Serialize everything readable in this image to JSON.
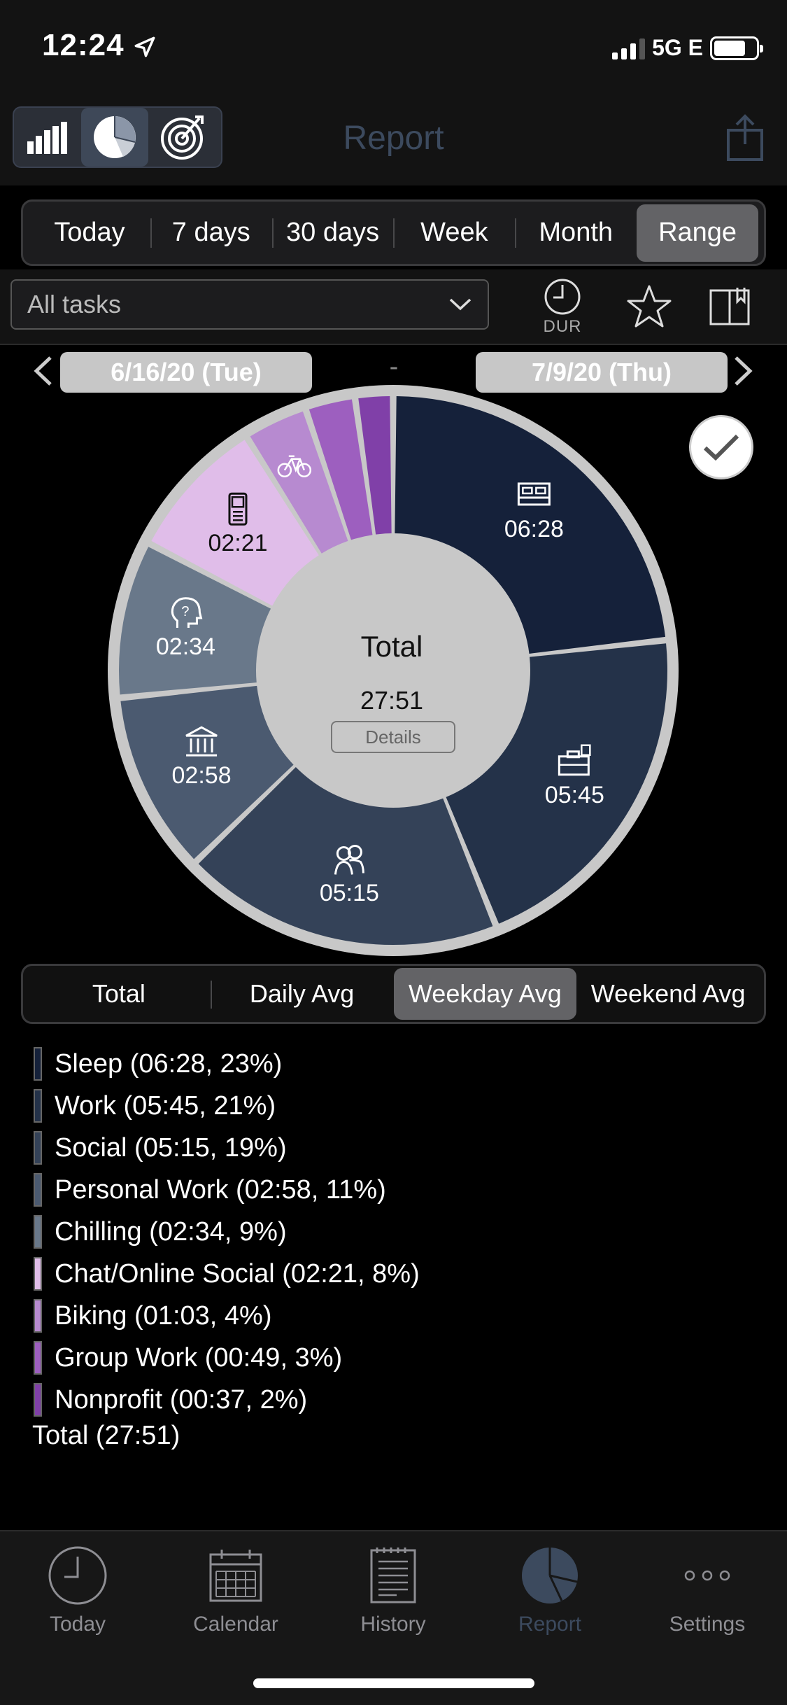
{
  "status_bar": {
    "time": "12:24",
    "network": "5G E"
  },
  "header": {
    "title": "Report",
    "view_icons": [
      "bar-chart-icon",
      "pie-chart-icon",
      "target-icon"
    ]
  },
  "range_tabs": [
    {
      "label": "Today",
      "active": false
    },
    {
      "label": "7 days",
      "active": false
    },
    {
      "label": "30 days",
      "active": false
    },
    {
      "label": "Week",
      "active": false
    },
    {
      "label": "Month",
      "active": false
    },
    {
      "label": "Range",
      "active": true
    }
  ],
  "filter": {
    "selected": "All tasks",
    "dur_label": "DUR"
  },
  "date_range": {
    "start": "6/16/20 (Tue)",
    "separator": "-",
    "end": "7/9/20 (Thu)"
  },
  "chart_center": {
    "title": "Total",
    "value": "27:51",
    "details_label": "Details"
  },
  "chart_data": {
    "type": "pie",
    "title": "",
    "slices": [
      {
        "name": "Sleep",
        "value": 6.4667,
        "label": "06:28",
        "color": "#15213a",
        "icon": "bed-icon"
      },
      {
        "name": "Work",
        "value": 5.75,
        "label": "05:45",
        "color": "#243249",
        "icon": "briefcase-icon"
      },
      {
        "name": "Social",
        "value": 5.25,
        "label": "05:15",
        "color": "#344258",
        "icon": "people-icon"
      },
      {
        "name": "Personal Work",
        "value": 2.9667,
        "label": "02:58",
        "color": "#4b5a70",
        "icon": "bank-icon"
      },
      {
        "name": "Chilling",
        "value": 2.5667,
        "label": "02:34",
        "color": "#69788a",
        "icon": "thinking-head-icon"
      },
      {
        "name": "Chat/Online Social",
        "value": 2.35,
        "label": "02:21",
        "color": "#e0bde9",
        "icon": "phone-icon"
      },
      {
        "name": "Biking",
        "value": 1.05,
        "label": "",
        "color": "#b78ad0",
        "icon": "bicycle-icon"
      },
      {
        "name": "Group Work",
        "value": 0.8167,
        "label": "",
        "color": "#9d5fbf",
        "icon": ""
      },
      {
        "name": "Nonprofit",
        "value": 0.6167,
        "label": "",
        "color": "#8040a8",
        "icon": ""
      }
    ]
  },
  "avg_tabs": [
    {
      "label": "Total",
      "active": false
    },
    {
      "label": "Daily Avg",
      "active": false
    },
    {
      "label": "Weekday Avg",
      "active": true
    },
    {
      "label": "Weekend Avg",
      "active": false
    }
  ],
  "legend": [
    {
      "text": "Sleep (06:28, 23%)",
      "color": "#15213a"
    },
    {
      "text": "Work (05:45, 21%)",
      "color": "#243249"
    },
    {
      "text": "Social (05:15, 19%)",
      "color": "#344258"
    },
    {
      "text": "Personal Work (02:58, 11%)",
      "color": "#4b5a70"
    },
    {
      "text": "Chilling (02:34, 9%)",
      "color": "#69788a"
    },
    {
      "text": "Chat/Online Social (02:21, 8%)",
      "color": "#e0bde9"
    },
    {
      "text": "Biking (01:03, 4%)",
      "color": "#b78ad0"
    },
    {
      "text": "Group Work (00:49, 3%)",
      "color": "#9d5fbf"
    },
    {
      "text": "Nonprofit (00:37, 2%)",
      "color": "#8040a8"
    }
  ],
  "legend_total": "Total (27:51)",
  "tab_bar": [
    {
      "label": "Today",
      "icon": "clock-icon",
      "active": false
    },
    {
      "label": "Calendar",
      "icon": "calendar-icon",
      "active": false
    },
    {
      "label": "History",
      "icon": "history-list-icon",
      "active": false
    },
    {
      "label": "Report",
      "icon": "pie-chart-icon",
      "active": true
    },
    {
      "label": "Settings",
      "icon": "more-dots-icon",
      "active": false
    }
  ]
}
